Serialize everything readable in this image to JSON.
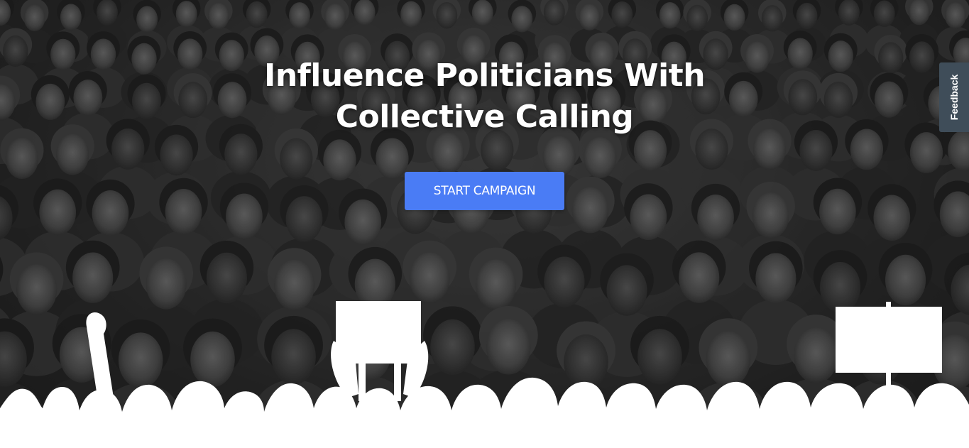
{
  "hero": {
    "headline_line1": "Influence Politicians With",
    "headline_line2": "Collective Calling",
    "cta_label": "START CAMPAIGN"
  },
  "feedback": {
    "label": "Feedback"
  },
  "colors": {
    "cta": "#4a7cf5",
    "feedback_tab": "#3f4d59",
    "silhouette": "#ffffff"
  }
}
